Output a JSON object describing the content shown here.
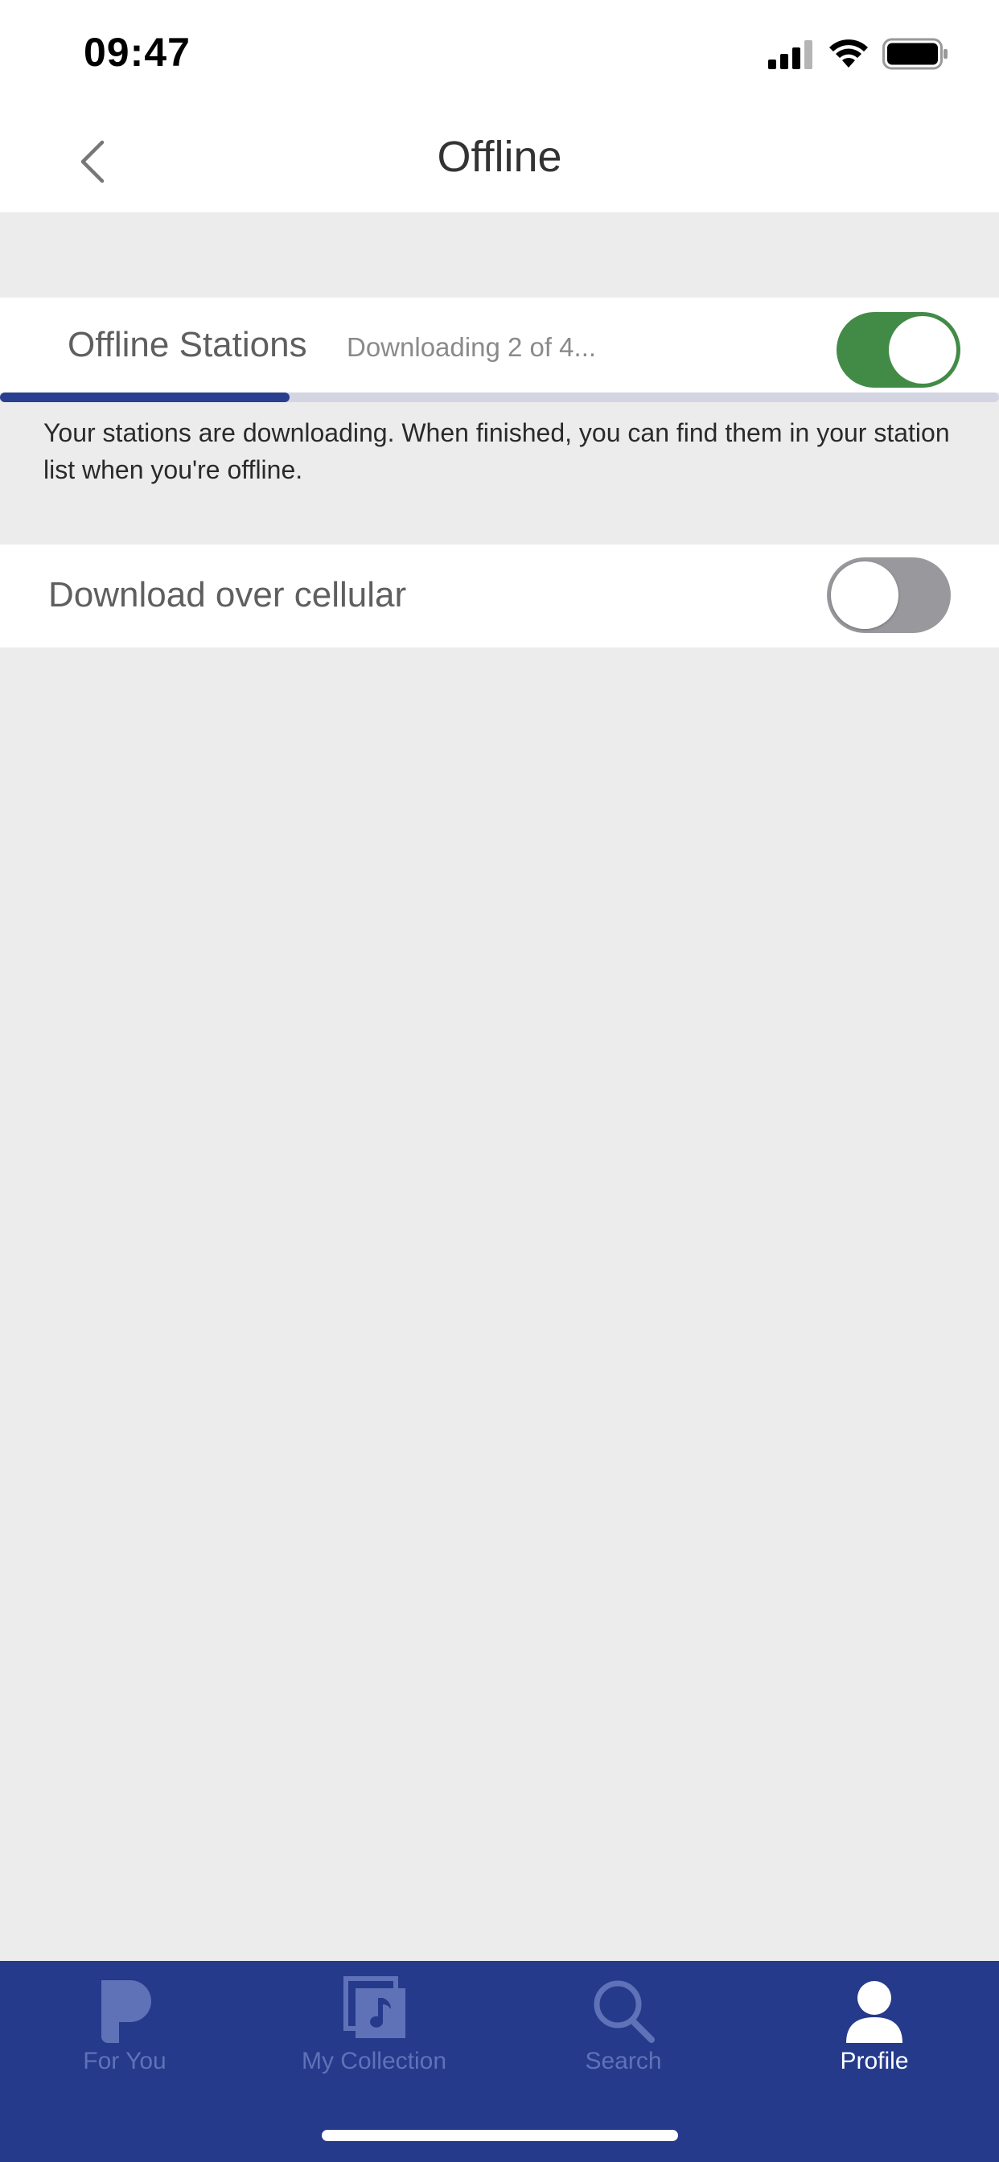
{
  "status_bar": {
    "time": "09:47",
    "icons": [
      "signal-icon",
      "wifi-icon",
      "battery-icon"
    ]
  },
  "header": {
    "title": "Offline",
    "back_icon": "chevron-left-icon"
  },
  "offline_stations": {
    "label": "Offline Stations",
    "status": "Downloading 2 of 4...",
    "enabled": true,
    "download_progress": 0.29,
    "info": "Your stations are downloading. When finished, you can find them in your station list when you're offline."
  },
  "cellular": {
    "label": "Download over cellular",
    "enabled": false
  },
  "tabs": [
    {
      "label": "For You",
      "icon": "pandora-p-icon",
      "active": false
    },
    {
      "label": "My Collection",
      "icon": "collection-icon",
      "active": false
    },
    {
      "label": "Search",
      "icon": "search-icon",
      "active": false
    },
    {
      "label": "Profile",
      "icon": "profile-icon",
      "active": true
    }
  ],
  "colors": {
    "tab_bar": "#253a8b",
    "toggle_on": "#428b47",
    "toggle_off": "#98989d",
    "progress": "#293f8f"
  }
}
